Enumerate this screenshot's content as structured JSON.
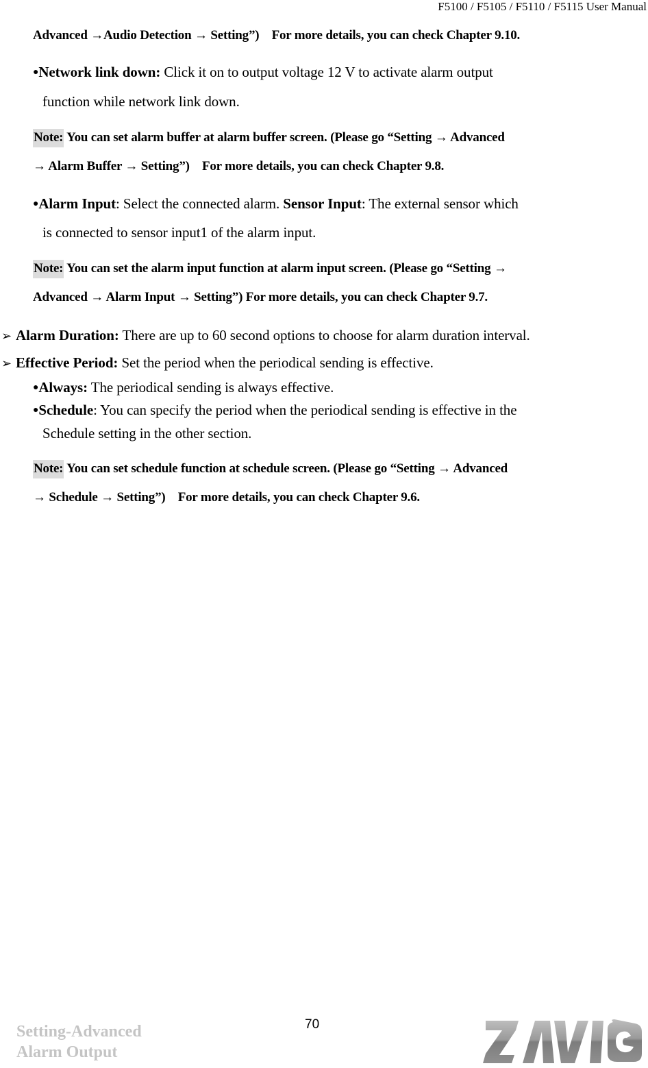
{
  "header": {
    "manual_title": "F5100 / F5105 / F5110 / F5115 User Manual"
  },
  "content": {
    "continuation": "Advanced →Audio Detection → Setting”)    For more details, you can check Chapter 9.10.",
    "network_link_down": {
      "label": "Network link down:",
      "text_line1": " Click it on to output voltage 12 V to activate alarm output",
      "text_line2": "function while network link down."
    },
    "note_alarm_buffer": {
      "label": "Note:",
      "line1": " You can set alarm buffer at alarm buffer screen. (Please go “Setting → Advanced",
      "line2": "→ Alarm Buffer → Setting”)    For more details, you can check Chapter 9.8."
    },
    "alarm_input": {
      "label": "Alarm Input",
      "text_a": ": Select the connected alarm. ",
      "sensor_label": "Sensor Input",
      "text_b": ": The external sensor which",
      "text_line2": "is connected to sensor input1 of the alarm input."
    },
    "note_alarm_input": {
      "label": "Note:",
      "line1": " You can set the alarm input function at alarm input screen. (Please go “Setting →",
      "line2": "Advanced → Alarm Input → Setting”) For more details, you can check Chapter 9.7."
    },
    "alarm_duration": {
      "label": "Alarm Duration:",
      "text": " There are up to 60 second options to choose for alarm duration interval."
    },
    "effective_period": {
      "label": "Effective Period:",
      "text": " Set the period when the periodical sending is effective."
    },
    "always": {
      "label": "Always:",
      "text": " The periodical sending is always effective."
    },
    "schedule": {
      "label": "Schedule",
      "text_line1": ": You can specify the period when the periodical sending is effective in the",
      "text_line2": "Schedule setting in the other section."
    },
    "note_schedule": {
      "label": "Note:",
      "line1": " You can set schedule function at schedule screen. (Please go “Setting → Advanced",
      "line2": "→ Schedule → Setting”)    For more details, you can check Chapter 9.6."
    },
    "icons": {
      "round_bullet": "●",
      "arrow_bullet": "➢"
    }
  },
  "footer": {
    "section_line1": "Setting-Advanced",
    "section_line2": "Alarm Output",
    "page_number": "70",
    "brand_logo_text": "ZAVIO"
  }
}
